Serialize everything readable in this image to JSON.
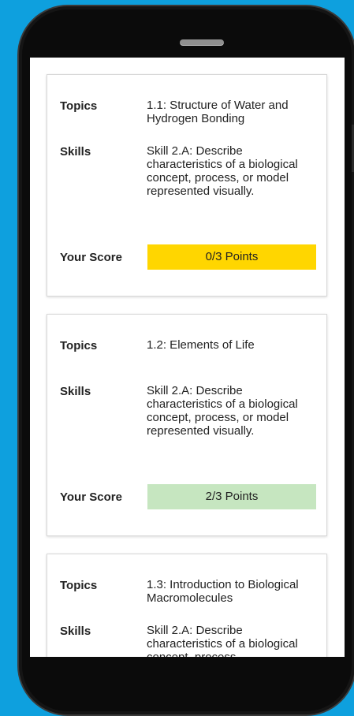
{
  "cards": [
    {
      "topics_label": "Topics",
      "topics_value": "1.1: Structure of Water and Hydrogen Bonding",
      "skills_label": "Skills",
      "skills_value": "Skill 2.A: Describe characteristics of a biological concept, process, or model represented visually.",
      "score_label": "Your Score",
      "score_value": "0/3 Points",
      "score_color": "#ffd600"
    },
    {
      "topics_label": "Topics",
      "topics_value": "1.2: Elements of Life",
      "skills_label": "Skills",
      "skills_value": "Skill 2.A: Describe characteristics of a biological concept, process, or model represented visually.",
      "score_label": "Your Score",
      "score_value": "2/3 Points",
      "score_color": "#c6e6c0"
    },
    {
      "topics_label": "Topics",
      "topics_value": "1.3: Introduction to Biological Macromolecules",
      "skills_label": "Skills",
      "skills_value": "Skill 2.A: Describe characteristics of a biological concept, process"
    }
  ],
  "colors": {
    "background": "#0ea0de",
    "phone_body": "#0b0b0b"
  }
}
